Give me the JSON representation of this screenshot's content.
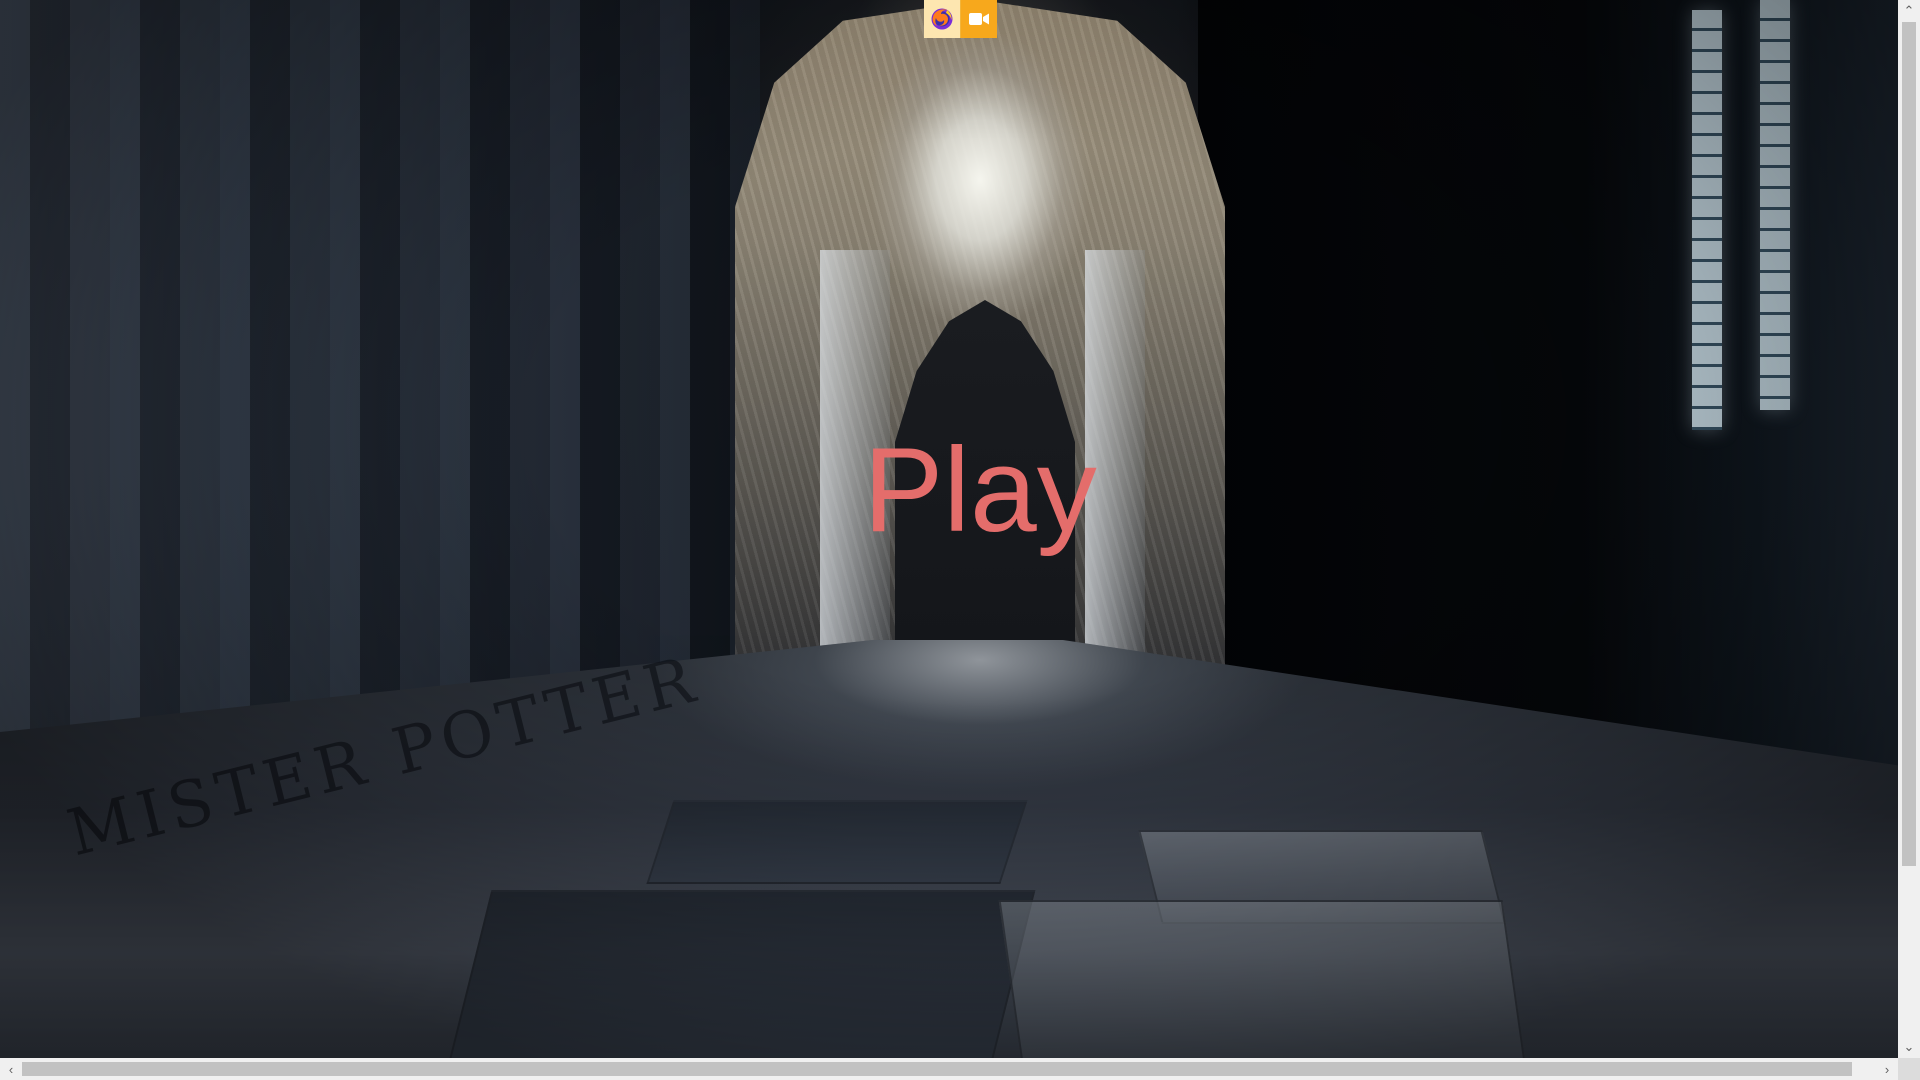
{
  "top_dock": {
    "items": [
      {
        "icon": "firefox-icon"
      },
      {
        "icon": "video-camera-icon"
      }
    ]
  },
  "main": {
    "play_label": "Play",
    "play_color": "#e46d6b",
    "background_graffiti": "MISTER POTTER"
  },
  "scrollbars": {
    "vertical": {
      "up": "⌃",
      "down": "⌄"
    },
    "horizontal": {
      "left": "‹",
      "right": "›"
    }
  }
}
